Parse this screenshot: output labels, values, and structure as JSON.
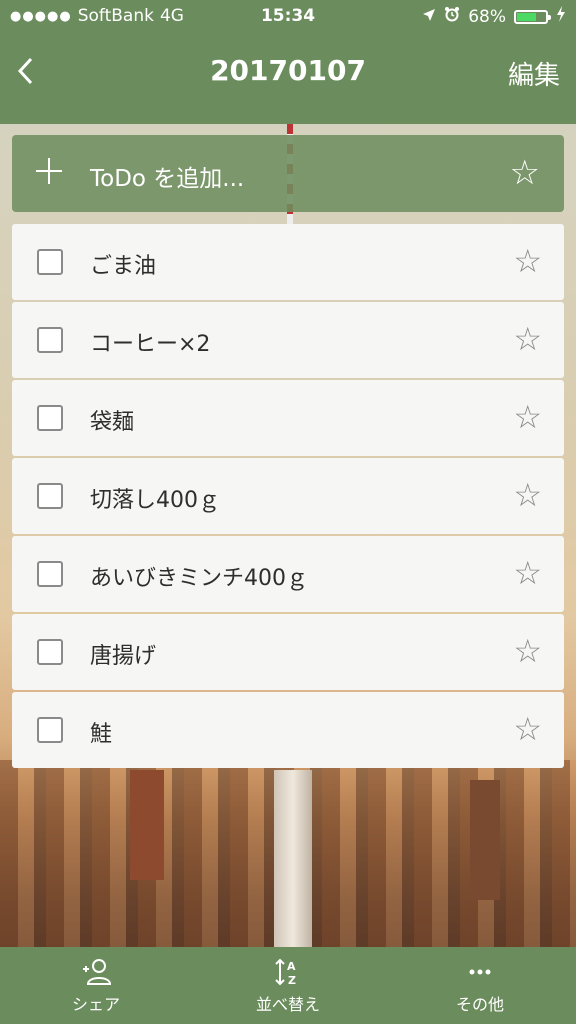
{
  "status_bar": {
    "signal": "●●●●●",
    "carrier": "SoftBank",
    "network": "4G",
    "time": "15:34",
    "battery_percent": "68%",
    "battery_level": 0.68
  },
  "nav": {
    "back_icon": "‹",
    "title": "20170107",
    "edit_label": "編集"
  },
  "add_bar": {
    "plus_icon": "＋",
    "placeholder": "ToDo を追加...",
    "star_icon": "☆"
  },
  "todos": [
    {
      "label": "ごま油",
      "checked": false,
      "starred": false
    },
    {
      "label": "コーヒー×2",
      "checked": false,
      "starred": false
    },
    {
      "label": "袋麺",
      "checked": false,
      "starred": false
    },
    {
      "label": "切落し400ｇ",
      "checked": false,
      "starred": false
    },
    {
      "label": "あいびきミンチ400ｇ",
      "checked": false,
      "starred": false
    },
    {
      "label": "唐揚げ",
      "checked": false,
      "starred": false
    },
    {
      "label": "鮭",
      "checked": false,
      "starred": false
    }
  ],
  "toolbar": {
    "share_label": "シェア",
    "sort_label": "並べ替え",
    "more_label": "その他"
  },
  "colors": {
    "bar_green": "#6b8c5c",
    "battery_green": "#4cd964"
  }
}
